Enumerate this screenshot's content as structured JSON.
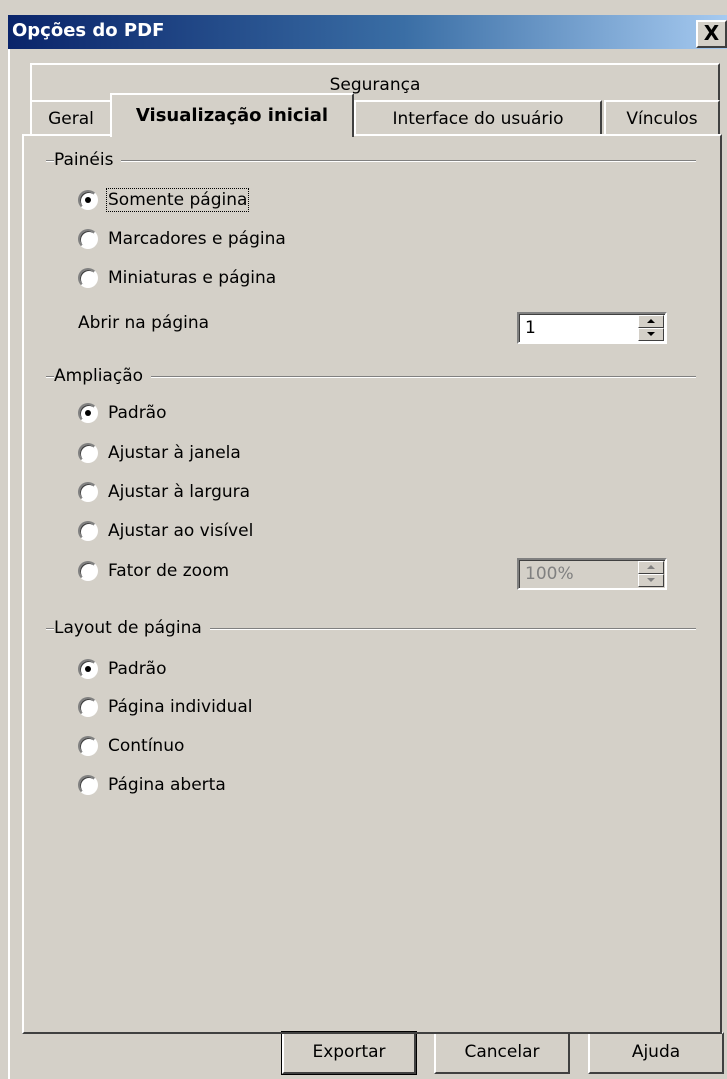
{
  "window": {
    "title": "Opções do PDF",
    "close_glyph": "X"
  },
  "tabs": {
    "row_back": [
      "Segurança"
    ],
    "row_front": [
      "Geral",
      "Visualização inicial",
      "Interface do usuário",
      "Vínculos"
    ],
    "active": "Visualização inicial"
  },
  "panels": {
    "label": "Painéis",
    "options": [
      "Somente página",
      "Marcadores e página",
      "Miniaturas e página"
    ],
    "selected": "Somente página",
    "open_page_label": "Abrir na página",
    "open_page_value": "1"
  },
  "magnification": {
    "label": "Ampliação",
    "options": [
      "Padrão",
      "Ajustar à janela",
      "Ajustar à largura",
      "Ajustar ao visível",
      "Fator de zoom"
    ],
    "selected": "Padrão",
    "zoom_value": "100%",
    "zoom_enabled": false
  },
  "page_layout": {
    "label": "Layout de página",
    "options": [
      "Padrão",
      "Página individual",
      "Contínuo",
      "Página aberta"
    ],
    "selected": "Padrão"
  },
  "buttons": {
    "export": "Exportar",
    "cancel": "Cancelar",
    "help": "Ajuda"
  },
  "icons": {
    "close": "close-icon",
    "spin_up": "spin-up-arrow-icon",
    "spin_down": "spin-down-arrow-icon"
  },
  "colors": {
    "face": "#d4d0c8",
    "title_start": "#0a246a",
    "title_end": "#a6caf0",
    "disabled_text": "#808080"
  }
}
